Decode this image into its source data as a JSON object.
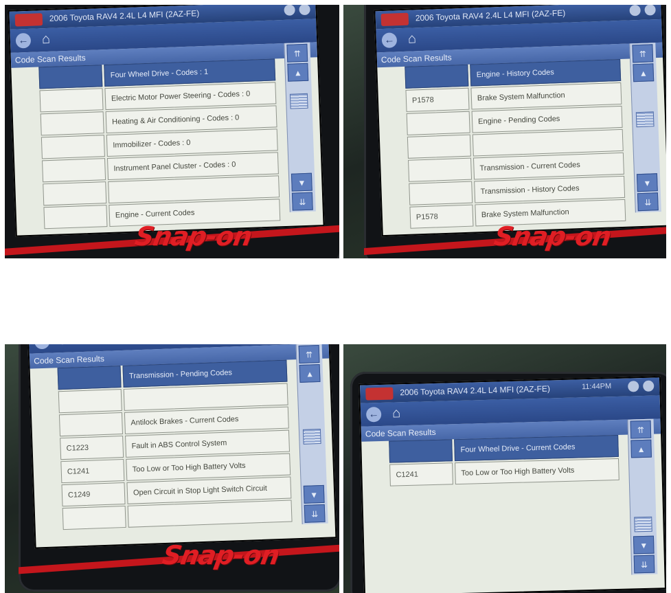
{
  "common": {
    "vehicle_title": "2006 Toyota RAV4 2.4L L4 MFI (2AZ-FE)",
    "section_title": "Code Scan Results",
    "clock": "11:44PM",
    "brand": "Snap-on",
    "back_glyph": "←",
    "home_glyph": "⌂",
    "scroll_glyphs": {
      "top": "⇈",
      "up": "▲",
      "down": "▼",
      "bottom": "⇊"
    },
    "icon_names": [
      "back-arrow-icon",
      "home-icon",
      "scroll-top-icon",
      "scroll-up-icon",
      "scroll-down-icon",
      "scroll-bottom-icon"
    ]
  },
  "panels": [
    {
      "rows": [
        {
          "code": "",
          "desc": "Four Wheel Drive - Codes : 1",
          "header": true
        },
        {
          "code": "",
          "desc": "Electric Motor Power Steering - Codes : 0"
        },
        {
          "code": "",
          "desc": "Heating & Air Conditioning - Codes : 0"
        },
        {
          "code": "",
          "desc": "Immobilizer - Codes : 0"
        },
        {
          "code": "",
          "desc": "Instrument Panel Cluster - Codes : 0"
        },
        {
          "code": "",
          "desc": ""
        },
        {
          "code": "",
          "desc": "Engine - Current Codes"
        }
      ]
    },
    {
      "rows": [
        {
          "code": "",
          "desc": "Engine - History Codes",
          "header": true
        },
        {
          "code": "P1578",
          "desc": "Brake System Malfunction"
        },
        {
          "code": "",
          "desc": "Engine - Pending Codes"
        },
        {
          "code": "",
          "desc": ""
        },
        {
          "code": "",
          "desc": "Transmission - Current Codes"
        },
        {
          "code": "",
          "desc": "Transmission - History Codes"
        },
        {
          "code": "P1578",
          "desc": "Brake System Malfunction"
        }
      ]
    },
    {
      "rows": [
        {
          "code": "",
          "desc": "Transmission - Pending Codes",
          "header": true
        },
        {
          "code": "",
          "desc": ""
        },
        {
          "code": "",
          "desc": "Antilock Brakes - Current Codes"
        },
        {
          "code": "C1223",
          "desc": "Fault in ABS Control System"
        },
        {
          "code": "C1241",
          "desc": "Too Low or Too High Battery Volts"
        },
        {
          "code": "C1249",
          "desc": "Open Circuit in Stop Light Switch Circuit"
        },
        {
          "code": "",
          "desc": ""
        }
      ]
    },
    {
      "rows": [
        {
          "code": "",
          "desc": "Four Wheel Drive - Current Codes",
          "header": true
        },
        {
          "code": "C1241",
          "desc": "Too Low or Too High Battery Volts"
        }
      ]
    }
  ]
}
